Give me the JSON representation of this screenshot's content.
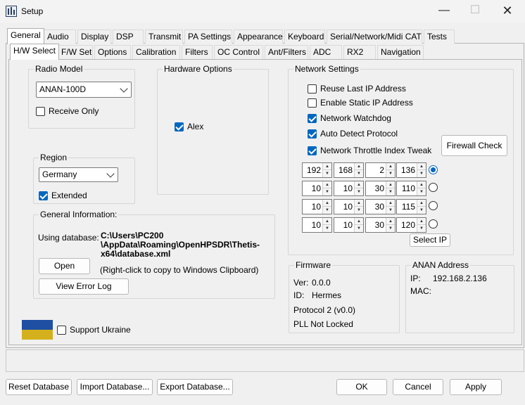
{
  "window": {
    "title": "Setup"
  },
  "main_tabs": [
    "General",
    "Audio",
    "Display",
    "DSP",
    "Transmit",
    "PA Settings",
    "Appearance",
    "Keyboard",
    "Serial/Network/Midi CAT",
    "Tests"
  ],
  "sub_tabs": [
    "H/W Select",
    "F/W Set",
    "Options",
    "Calibration",
    "Filters",
    "OC Control",
    "Ant/Filters",
    "ADC",
    "RX2",
    "Navigation"
  ],
  "radio_model": {
    "title": "Radio Model",
    "selected": "ANAN-100D",
    "receive_only": "Receive Only"
  },
  "hardware_options": {
    "title": "Hardware Options",
    "alex": "Alex"
  },
  "region": {
    "title": "Region",
    "selected": "Germany",
    "extended": "Extended"
  },
  "general_info": {
    "title": "General Information:",
    "using_database_label": "Using database:",
    "database_path_l1": "C:\\Users\\PC200",
    "database_path_l2": "\\AppData\\Roaming\\OpenHPSDR\\Thetis-",
    "database_path_l3": "x64\\database.xml",
    "open_button": "Open",
    "clipboard_hint": "(Right-click to copy to Windows Clipboard)",
    "view_error_log_button": "View Error Log"
  },
  "support_ukraine": "Support Ukraine",
  "network": {
    "title": "Network Settings",
    "reuse_last_ip": "Reuse Last IP Address",
    "enable_static_ip": "Enable Static IP Address",
    "network_watchdog": "Network Watchdog",
    "auto_detect_protocol": "Auto Detect Protocol",
    "throttle_tweak": "Network Throttle Index Tweak",
    "firewall_button": "Firewall Check",
    "ip_rows": [
      [
        "192",
        "168",
        "2",
        "136"
      ],
      [
        "10",
        "10",
        "30",
        "110"
      ],
      [
        "10",
        "10",
        "30",
        "115"
      ],
      [
        "10",
        "10",
        "30",
        "120"
      ]
    ],
    "select_ip_button": "Select IP"
  },
  "firmware": {
    "title": "Firmware",
    "ver_label": "Ver:",
    "ver_value": "0.0.0",
    "id_label": "ID:",
    "id_value": "Hermes",
    "protocol": "Protocol 2 (v0.0)",
    "pll": "PLL Not Locked"
  },
  "anan_address": {
    "title": "ANAN Address",
    "ip_label": "IP:",
    "ip_value": "192.168.2.136",
    "mac_label": "MAC:"
  },
  "footer": {
    "reset_db": "Reset Database",
    "import_db": "Import Database...",
    "export_db": "Export Database...",
    "ok": "OK",
    "cancel": "Cancel",
    "apply": "Apply"
  },
  "colors": {
    "accent": "#0067c0",
    "flag_blue": "#1f4fa3",
    "flag_yellow": "#d4b11c"
  }
}
